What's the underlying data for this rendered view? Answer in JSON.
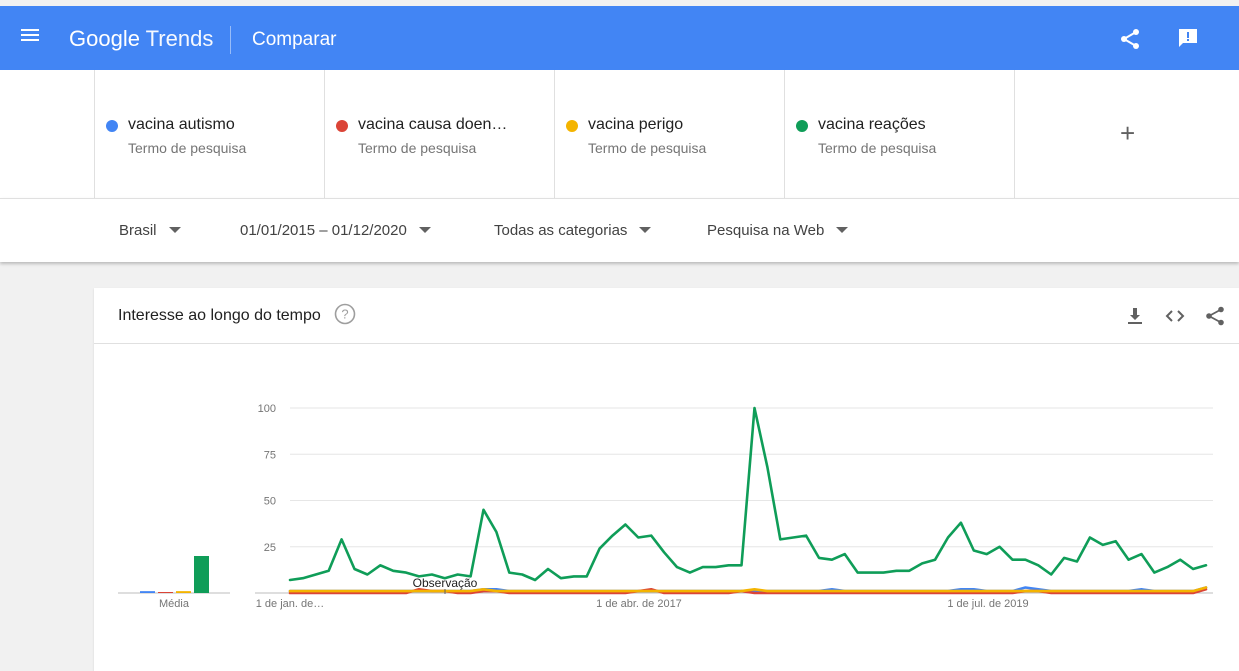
{
  "app": {
    "logo_google": "Google",
    "logo_trends": "Trends",
    "page_title": "Comparar",
    "brand_color": "#4285f4",
    "icons": [
      "menu-icon",
      "share-icon",
      "feedback-icon"
    ]
  },
  "terms": [
    {
      "name": "vacina autismo",
      "type": "Termo de pesquisa",
      "color": "#4285f4"
    },
    {
      "name": "vacina causa doen…",
      "type": "Termo de pesquisa",
      "color": "#db4437"
    },
    {
      "name": "vacina perigo",
      "type": "Termo de pesquisa",
      "color": "#f4b400"
    },
    {
      "name": "vacina reações",
      "type": "Termo de pesquisa",
      "color": "#0f9d58"
    }
  ],
  "add_term": "+",
  "filters": {
    "region": "Brasil",
    "date_range": "01/01/2015 – 01/12/2020",
    "category": "Todas as categorias",
    "search_type": "Pesquisa na Web"
  },
  "card": {
    "title": "Interesse ao longo do tempo",
    "help": "?"
  },
  "chart_data": {
    "type": "line",
    "y_ticks": [
      "100",
      "75",
      "50",
      "25"
    ],
    "ylim": [
      0,
      100
    ],
    "x_tick_labels": [
      "1 de jan. de…",
      "1 de abr. de 2017",
      "1 de jul. de 2019"
    ],
    "note_label": "Observação",
    "average_label": "Média",
    "averages": [
      {
        "term": "vacina autismo",
        "value": 1,
        "color": "#4285f4"
      },
      {
        "term": "vacina causa doen…",
        "value": 0,
        "color": "#db4437"
      },
      {
        "term": "vacina perigo",
        "value": 1,
        "color": "#f4b400"
      },
      {
        "term": "vacina reações",
        "value": 20,
        "color": "#0f9d58"
      }
    ],
    "series": [
      {
        "name": "vacina reações",
        "color": "#0f9d58",
        "values": [
          7,
          8,
          10,
          12,
          29,
          13,
          10,
          15,
          12,
          11,
          9,
          10,
          8,
          10,
          9,
          45,
          33,
          11,
          10,
          7,
          13,
          8,
          9,
          9,
          24,
          31,
          37,
          30,
          31,
          22,
          14,
          11,
          14,
          14,
          15,
          15,
          100,
          68,
          29,
          30,
          31,
          19,
          18,
          21,
          11,
          11,
          11,
          12,
          12,
          16,
          18,
          30,
          38,
          23,
          21,
          25,
          18,
          18,
          15,
          10,
          19,
          17,
          30,
          26,
          28,
          18,
          21,
          11,
          14,
          18,
          13,
          15
        ]
      },
      {
        "name": "vacina autismo",
        "color": "#4285f4",
        "values": [
          1,
          1,
          1,
          1,
          1,
          1,
          1,
          1,
          1,
          1,
          1,
          1,
          1,
          1,
          1,
          2,
          2,
          1,
          1,
          1,
          1,
          1,
          1,
          1,
          1,
          1,
          1,
          1,
          1,
          1,
          1,
          1,
          1,
          1,
          1,
          1,
          1,
          1,
          1,
          1,
          1,
          1,
          2,
          1,
          1,
          1,
          1,
          1,
          1,
          1,
          1,
          1,
          2,
          2,
          1,
          1,
          1,
          3,
          2,
          1,
          1,
          1,
          1,
          1,
          1,
          1,
          2,
          1,
          1,
          1,
          1,
          3
        ]
      },
      {
        "name": "vacina causa doen…",
        "color": "#db4437",
        "values": [
          0,
          0,
          0,
          0,
          0,
          0,
          0,
          0,
          0,
          0,
          2,
          1,
          1,
          0,
          0,
          1,
          1,
          0,
          0,
          0,
          0,
          0,
          0,
          0,
          0,
          0,
          0,
          1,
          2,
          0,
          0,
          0,
          0,
          0,
          0,
          1,
          0,
          0,
          0,
          0,
          0,
          0,
          0,
          0,
          0,
          0,
          0,
          0,
          0,
          0,
          0,
          0,
          0,
          0,
          0,
          0,
          0,
          1,
          1,
          0,
          0,
          0,
          0,
          0,
          0,
          0,
          0,
          0,
          0,
          0,
          0,
          2
        ]
      },
      {
        "name": "vacina perigo",
        "color": "#f4b400",
        "values": [
          1,
          1,
          1,
          1,
          1,
          1,
          1,
          1,
          1,
          1,
          1,
          1,
          1,
          1,
          1,
          2,
          1,
          1,
          1,
          1,
          1,
          1,
          1,
          1,
          1,
          1,
          1,
          1,
          1,
          1,
          1,
          1,
          1,
          1,
          1,
          1,
          2,
          1,
          1,
          1,
          1,
          1,
          1,
          1,
          1,
          1,
          1,
          1,
          1,
          1,
          1,
          1,
          1,
          1,
          1,
          1,
          1,
          1,
          1,
          1,
          1,
          1,
          1,
          1,
          1,
          1,
          1,
          1,
          1,
          1,
          1,
          3
        ]
      }
    ]
  }
}
